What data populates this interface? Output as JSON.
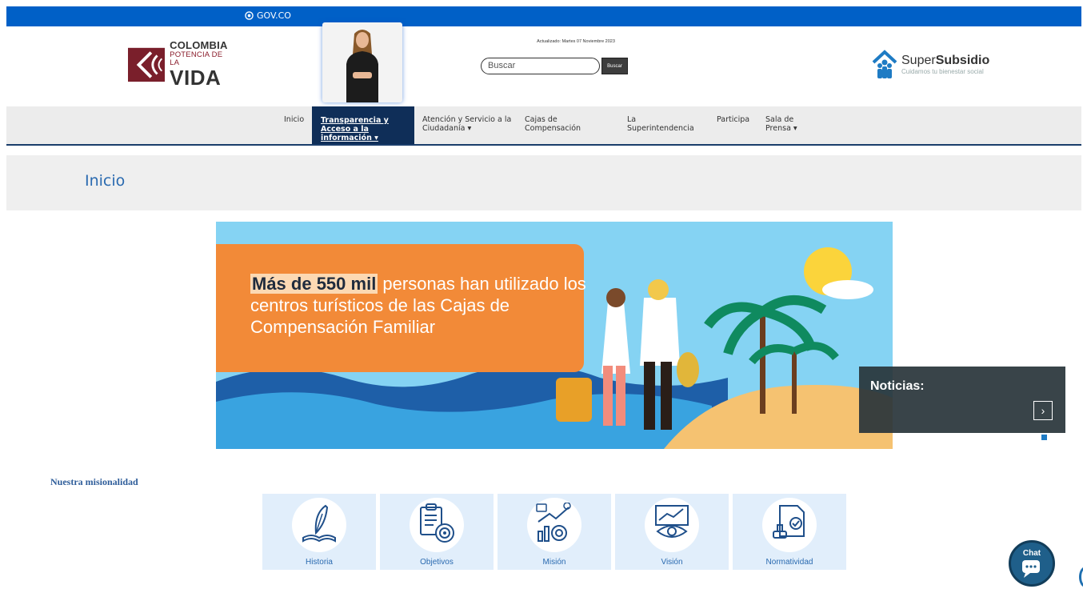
{
  "gov_bar": {
    "label": "GOV.CO"
  },
  "header": {
    "logo_line1": "COLOMBIA",
    "logo_line2": "POTENCIA DE LA",
    "logo_line3": "VIDA",
    "updated": "Actualizado: Martes 07 Noviembre 2023",
    "search_placeholder": "Buscar",
    "search_button": "Buscar",
    "brand_light": "Super",
    "brand_bold": "Subsidio",
    "brand_tagline": "Cuidamos tu bienestar social"
  },
  "nav": {
    "items": [
      {
        "label": "Inicio"
      },
      {
        "label": "Transparencia y Acceso a la información ▾"
      },
      {
        "label": "Atención y Servicio a la Ciudadanía ▾"
      },
      {
        "label": "Cajas de Compensación"
      },
      {
        "label": "La Superintendencia"
      },
      {
        "label": "Participa"
      },
      {
        "label": "Sala de Prensa ▾"
      }
    ]
  },
  "breadcrumb": {
    "current": "Inicio"
  },
  "banner": {
    "highlight": "Más de 550 mil",
    "text": " personas han utilizado los centros turísticos de las Cajas de Compensación Familiar"
  },
  "news": {
    "title": "Noticias:",
    "next": "›"
  },
  "mision": {
    "title": "Nuestra misionalidad",
    "cards": [
      {
        "label": "Historia",
        "icon": "quill-book-icon"
      },
      {
        "label": "Objetivos",
        "icon": "clipboard-target-icon"
      },
      {
        "label": "Misión",
        "icon": "growth-chart-icon"
      },
      {
        "label": "Visión",
        "icon": "eye-chart-icon"
      },
      {
        "label": "Normatividad",
        "icon": "document-stamp-icon"
      }
    ]
  },
  "chat": {
    "label": "Chat"
  },
  "colors": {
    "gov_blue": "#0060c7",
    "nav_active": "#0f2e58",
    "link_blue": "#2a6ab0",
    "banner_orange": "#f28a38",
    "banner_sky": "#85d3f3"
  }
}
